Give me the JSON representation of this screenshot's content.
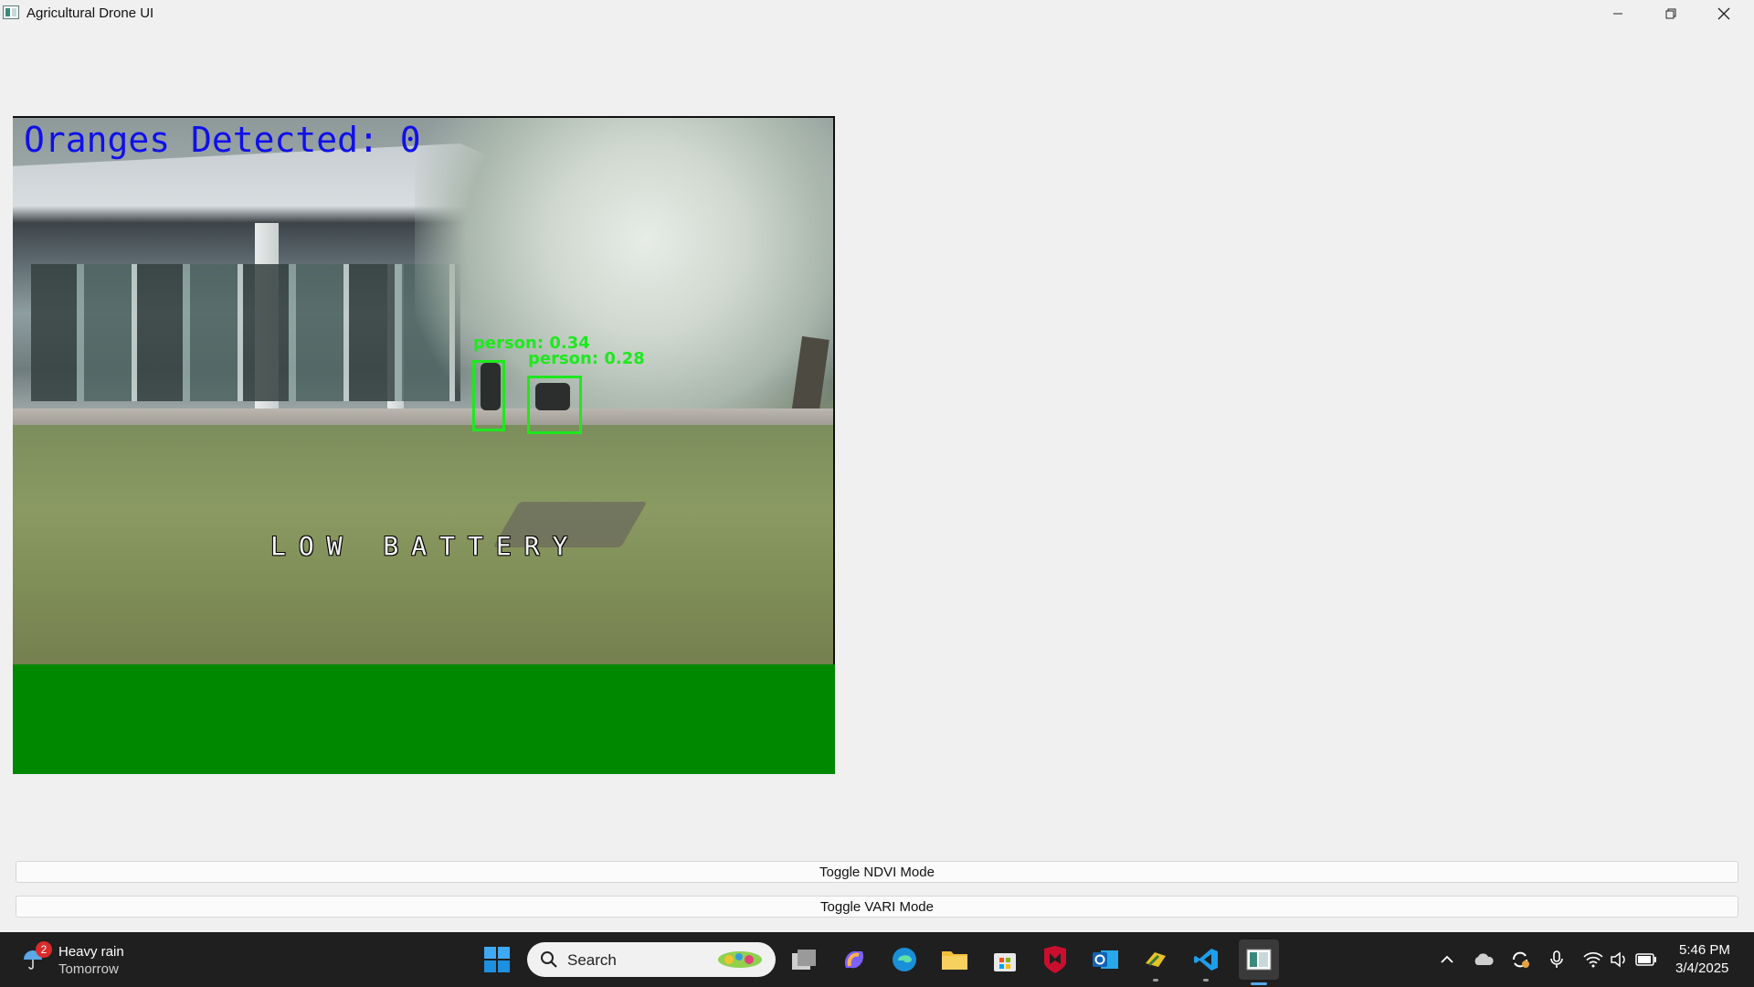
{
  "window": {
    "title": "Agricultural Drone UI",
    "controls": [
      "minimize-icon",
      "restore-icon",
      "close-icon"
    ]
  },
  "video": {
    "overlay_count": "Oranges Detected: 0",
    "overlay_warning": "LOW BATTERY",
    "detections": [
      {
        "label": "person: 0.34"
      },
      {
        "label": "person: 0.28"
      }
    ],
    "panel_color": "#008800",
    "overlay_count_color": "#1010e8",
    "detection_color": "#1ee81e"
  },
  "controls": {
    "ndvi_label": "Toggle NDVI Mode",
    "vari_label": "Toggle VARI Mode"
  },
  "taskbar": {
    "weather": {
      "badge": "2",
      "title": "Heavy rain",
      "subtitle": "Tomorrow",
      "icon": "umbrella-icon"
    },
    "search_placeholder": "Search",
    "apps": [
      "windows-start-icon",
      "search-icon",
      "task-view-icon",
      "copilot-icon",
      "edge-icon",
      "file-explorer-icon",
      "microsoft-store-icon",
      "mcafee-icon",
      "outlook-icon",
      "python-app-icon",
      "vscode-icon",
      "drone-ui-icon"
    ],
    "tray": [
      "chevron-up-icon",
      "onedrive-icon",
      "sync-icon",
      "microphone-icon",
      "wifi-icon",
      "volume-icon",
      "battery-icon"
    ],
    "time": "5:46 PM",
    "date": "3/4/2025"
  }
}
